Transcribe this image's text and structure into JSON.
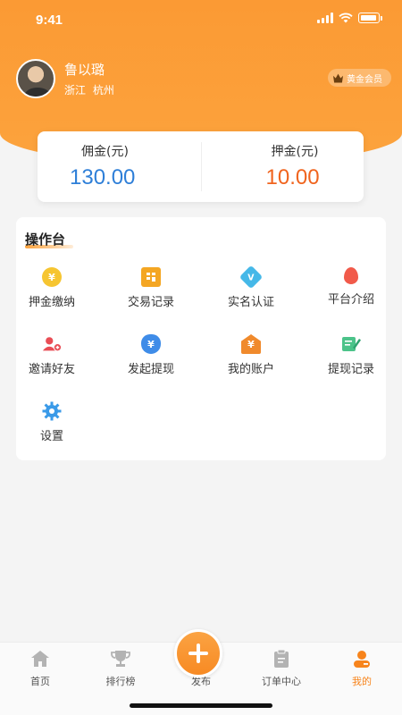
{
  "status_bar": {
    "time": "9:41"
  },
  "profile": {
    "name": "鲁以璐",
    "location": "浙江   杭州",
    "badge": "黄金会员"
  },
  "money": {
    "commission_label": "佣金(元)",
    "commission_value": "130.00",
    "deposit_label": "押金(元)",
    "deposit_value": "10.00"
  },
  "workbench": {
    "title": "操作台",
    "items": [
      {
        "label": "押金缴纳",
        "icon": "coin-icon",
        "color": "#f6c531"
      },
      {
        "label": "交易记录",
        "icon": "calculator-icon",
        "color": "#f4a623"
      },
      {
        "label": "实名认证",
        "icon": "verified-diamond-icon",
        "color": "#45b8e8"
      },
      {
        "label": "平台介绍",
        "icon": "balloon-icon",
        "color": "#f15a4a"
      },
      {
        "label": "邀请好友",
        "icon": "add-user-icon",
        "color": "#e94d55"
      },
      {
        "label": "发起提现",
        "icon": "money-bag-icon",
        "color": "#3f8ce8"
      },
      {
        "label": "我的账户",
        "icon": "account-house-icon",
        "color": "#f08a2c"
      },
      {
        "label": "提现记录",
        "icon": "edit-document-icon",
        "color": "#4cc38a"
      },
      {
        "label": "设置",
        "icon": "gear-icon",
        "color": "#3a9ae8"
      }
    ]
  },
  "tabbar": {
    "items": [
      {
        "label": "首页",
        "icon": "home-icon"
      },
      {
        "label": "排行榜",
        "icon": "trophy-icon"
      },
      {
        "label": "发布",
        "icon": "plus-icon"
      },
      {
        "label": "订单中心",
        "icon": "clipboard-icon"
      },
      {
        "label": "我的",
        "icon": "user-icon"
      }
    ],
    "active": "我的",
    "accent": "#f7841c"
  }
}
